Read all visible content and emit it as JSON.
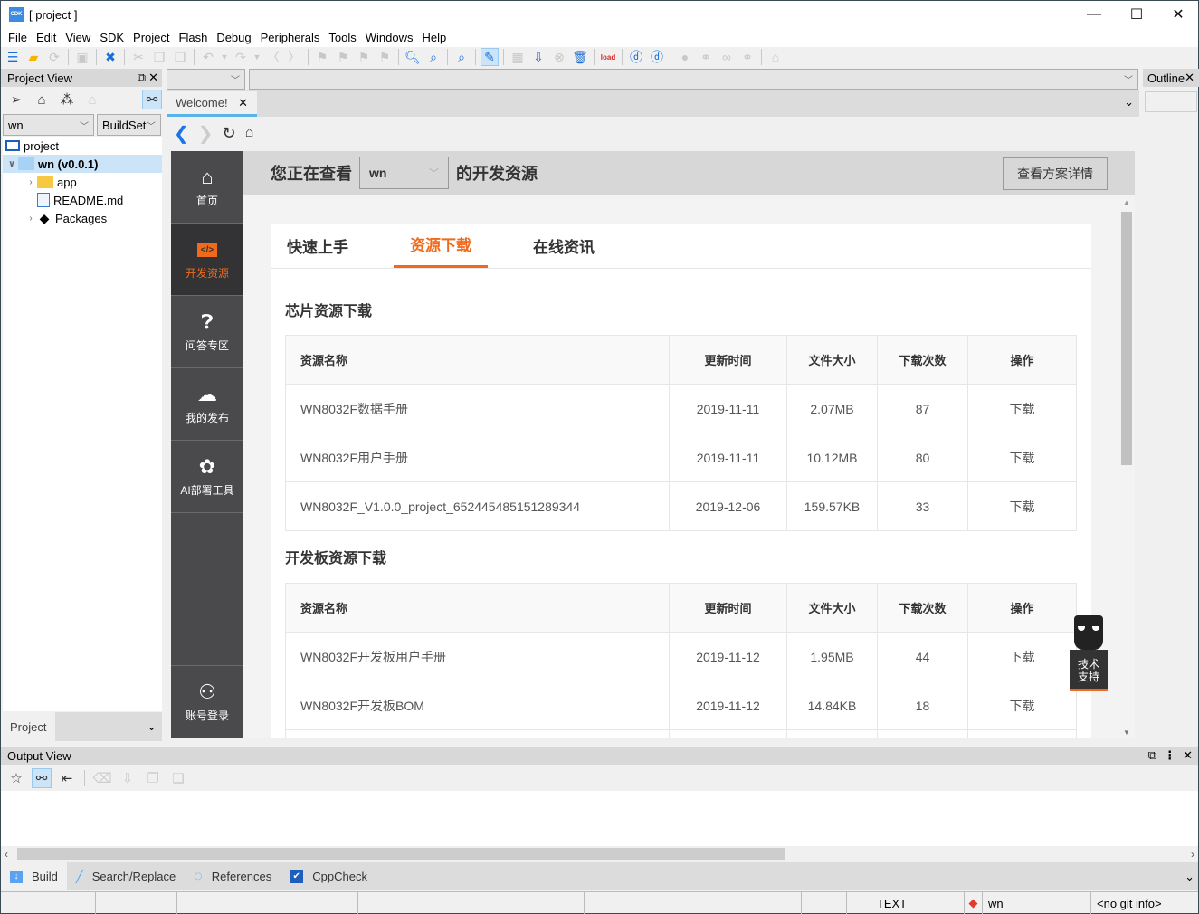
{
  "window": {
    "title": "[ project ]",
    "app_icon": "CDK",
    "controls": [
      "minimize",
      "maximize",
      "close"
    ]
  },
  "menu": [
    "File",
    "Edit",
    "View",
    "SDK",
    "Project",
    "Flash",
    "Debug",
    "Peripherals",
    "Tools",
    "Windows",
    "Help"
  ],
  "toolbar": {
    "icons": [
      "new-file-icon",
      "open-folder-icon",
      "reload-icon",
      "sep",
      "save-icon",
      "sep",
      "close-x-icon",
      "sep",
      "cut-icon",
      "copy-icon",
      "paste-icon",
      "sep",
      "undo-icon",
      "dropdown-icon",
      "redo-icon",
      "dropdown-icon",
      "back-icon",
      "forward-icon",
      "sep",
      "flag-icon",
      "flag-next-icon",
      "flag-prev-icon",
      "flag-clear-icon",
      "sep",
      "search-icon",
      "find-in-files-icon",
      "sep",
      "find-window-icon",
      "sep",
      "build-icon",
      "sep",
      "package-icon",
      "download-icon",
      "stop-icon",
      "erase-icon",
      "sep",
      "load-icon",
      "sep",
      "debug-icon",
      "debug-search-icon",
      "sep",
      "circle-icon",
      "connect-icon",
      "link-icon",
      "disconnect-icon",
      "sep",
      "home-icon"
    ]
  },
  "project_view": {
    "title": "Project View",
    "tool_icons": [
      "locate-icon",
      "building-icon",
      "wand-icon",
      "home-icon",
      "link-icon"
    ],
    "target_select": "wn",
    "buildset_select": "BuildSet",
    "tree": [
      {
        "label": "project",
        "icon": "monitor-icon",
        "level": 0,
        "expanded": null
      },
      {
        "label": "wn (v0.0.1)",
        "icon": "folder-icon",
        "level": 1,
        "expanded": true,
        "selected": true
      },
      {
        "label": "app",
        "icon": "folder-icon",
        "level": 2,
        "expanded": false
      },
      {
        "label": "README.md",
        "icon": "file-icon",
        "level": 2,
        "expanded": null
      },
      {
        "label": "Packages",
        "icon": "packages-icon",
        "level": 2,
        "expanded": false
      }
    ],
    "footer_label": "Project",
    "footer_select": ""
  },
  "editor": {
    "tab_label": "Welcome!",
    "nav": [
      "back-icon",
      "forward-icon",
      "refresh-icon",
      "home-icon"
    ]
  },
  "web": {
    "sidenav": [
      {
        "label": "首页",
        "icon": "home-icon",
        "active": false
      },
      {
        "label": "开发资源",
        "icon": "code-folder-icon",
        "active": true
      },
      {
        "label": "问答专区",
        "icon": "question-chat-icon",
        "active": false
      },
      {
        "label": "我的发布",
        "icon": "cloud-upload-icon",
        "active": false
      },
      {
        "label": "AI部署工具",
        "icon": "ai-gear-icon",
        "active": false
      }
    ],
    "login_label": "账号登录",
    "viewing_prefix": "您正在查看",
    "product": "wn",
    "viewing_suffix": "的开发资源",
    "detail_button": "查看方案详情",
    "tabs": [
      {
        "label": "快速上手",
        "active": false
      },
      {
        "label": "资源下载",
        "active": true
      },
      {
        "label": "在线资讯",
        "active": false
      }
    ],
    "columns": [
      "资源名称",
      "更新时间",
      "文件大小",
      "下载次数",
      "操作"
    ],
    "sections": [
      {
        "title": "芯片资源下载",
        "rows": [
          {
            "name": "WN8032F数据手册",
            "date": "2019-11-11",
            "size": "2.07MB",
            "downloads": "87",
            "action": "下载"
          },
          {
            "name": "WN8032F用户手册",
            "date": "2019-11-11",
            "size": "10.12MB",
            "downloads": "80",
            "action": "下载"
          },
          {
            "name": "WN8032F_V1.0.0_project_652445485151289344",
            "date": "2019-12-06",
            "size": "159.57KB",
            "downloads": "33",
            "action": "下载"
          }
        ]
      },
      {
        "title": "开发板资源下载",
        "rows": [
          {
            "name": "WN8032F开发板用户手册",
            "date": "2019-11-12",
            "size": "1.95MB",
            "downloads": "44",
            "action": "下载"
          },
          {
            "name": "WN8032F开发板BOM",
            "date": "2019-11-12",
            "size": "14.84KB",
            "downloads": "18",
            "action": "下载"
          }
        ]
      }
    ],
    "support_label_1": "技术",
    "support_label_2": "支持",
    "accent_color": "#f16a1b"
  },
  "outline": {
    "title": "Outline"
  },
  "output_view": {
    "title": "Output View",
    "icons": [
      "star-icon",
      "link-icon",
      "indent-icon",
      "clear-icon",
      "export-icon",
      "copy-icon",
      "paste-icon"
    ],
    "tabs": [
      {
        "label": "Build",
        "icon": "build-arrow-icon",
        "active": true
      },
      {
        "label": "Search/Replace",
        "icon": "pencil-icon",
        "active": false
      },
      {
        "label": "References",
        "icon": "circle-ref-icon",
        "active": false
      },
      {
        "label": "CppCheck",
        "icon": "checkbox-icon",
        "active": false
      }
    ]
  },
  "statusbar": {
    "encoding": "TEXT",
    "project": "wn",
    "git": "<no git info>"
  }
}
